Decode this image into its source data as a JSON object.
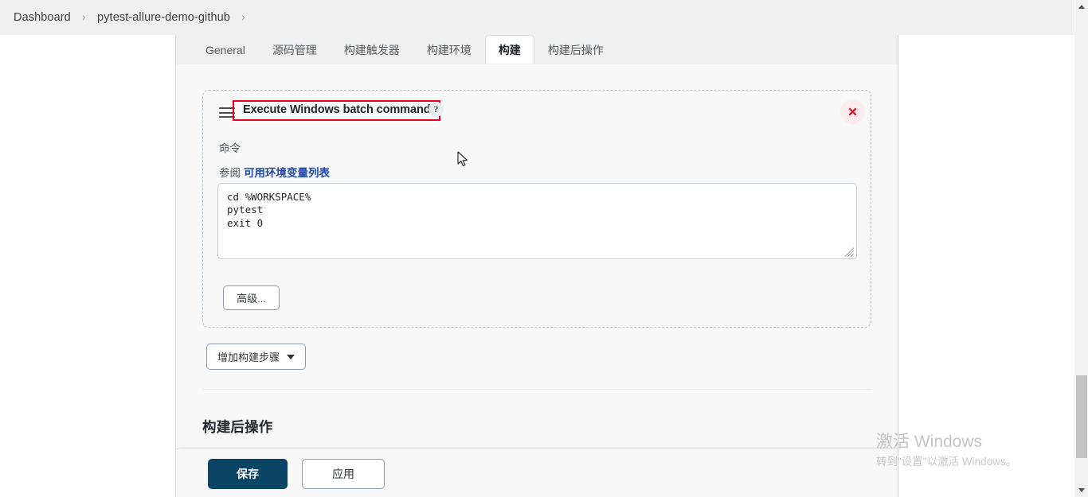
{
  "breadcrumb": {
    "items": [
      {
        "label": "Dashboard"
      },
      {
        "label": "pytest-allure-demo-github"
      }
    ],
    "separator": "›"
  },
  "tabs": [
    {
      "label": "General",
      "active": false
    },
    {
      "label": "源码管理",
      "active": false
    },
    {
      "label": "构建触发器",
      "active": false
    },
    {
      "label": "构建环境",
      "active": false
    },
    {
      "label": "构建",
      "active": true
    },
    {
      "label": "构建后操作",
      "active": false
    }
  ],
  "build_step": {
    "title": "Execute Windows batch command",
    "title_highlight_color": "#e8001f",
    "help_icon_label": "?",
    "drag_handle_icon": "hamburger-drag-icon",
    "close_icon": "close-x-icon",
    "command_label": "命令",
    "see_also_prefix": "参阅",
    "see_also_link": "可用环境变量列表",
    "command_value": "cd %WORKSPACE%\npytest\nexit 0",
    "command_placeholder": "",
    "advanced_label": "高级..."
  },
  "add_step": {
    "label": "增加构建步骤",
    "caret_icon": "chevron-down-icon"
  },
  "post_build": {
    "heading": "构建后操作"
  },
  "actions": {
    "save_label": "保存",
    "apply_label": "应用",
    "save_color": "#0b4566"
  },
  "watermark": {
    "title": "激活 Windows",
    "subtitle": "转到\"设置\"以激活 Windows。"
  },
  "scrollbar": {
    "up_icon": "scroll-up-arrow-icon",
    "down_icon": "scroll-down-arrow-icon"
  }
}
